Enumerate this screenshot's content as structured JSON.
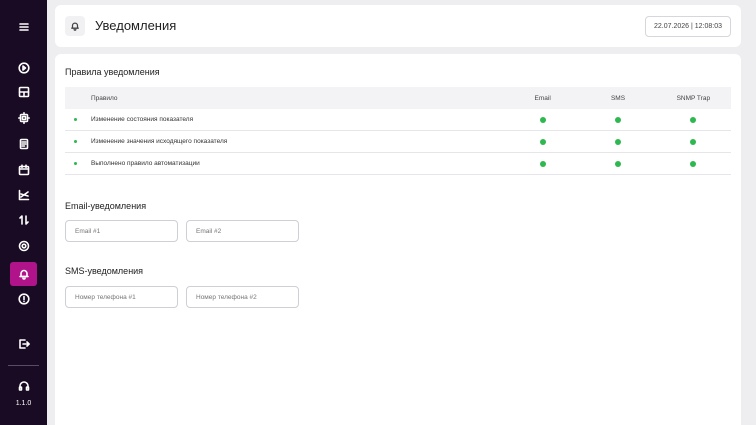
{
  "sidebar": {
    "menu_icon": "menu-icon",
    "items": [
      {
        "icon": "play-circle-icon",
        "active": false
      },
      {
        "icon": "dashboard-icon",
        "active": false
      },
      {
        "icon": "chip-icon",
        "active": false
      },
      {
        "icon": "document-icon",
        "active": false
      },
      {
        "icon": "calendar-icon",
        "active": false
      },
      {
        "icon": "chart-icon",
        "active": false
      },
      {
        "icon": "transfer-icon",
        "active": false
      },
      {
        "icon": "settings-icon",
        "active": false
      },
      {
        "icon": "bell-icon",
        "active": true
      },
      {
        "icon": "info-icon",
        "active": false
      }
    ],
    "logout_icon": "logout-icon",
    "support_icon": "headset-icon",
    "version": "1.1.0"
  },
  "header": {
    "title": "Уведомления",
    "datetime": "22.07.2026 | 12:08:03"
  },
  "rules": {
    "title": "Правила уведомления",
    "columns": [
      "Правило",
      "Email",
      "SMS",
      "SNMP Trap"
    ],
    "rows": [
      {
        "name": "Изменение состояния показателя",
        "email": true,
        "sms": true,
        "snmp": true
      },
      {
        "name": "Изменение значения исходящего показателя",
        "email": true,
        "sms": true,
        "snmp": true
      },
      {
        "name": "Выполнено правило автоматизации",
        "email": true,
        "sms": true,
        "snmp": true
      }
    ]
  },
  "email": {
    "title": "Email-уведомления",
    "placeholder1": "Email #1",
    "placeholder2": "Email #2"
  },
  "sms": {
    "title": "SMS-уведомления",
    "placeholder1": "Номер телефона #1",
    "placeholder2": "Номер телефона #2"
  },
  "colors": {
    "sidebar_bg": "#1a0b24",
    "accent": "#b1148a",
    "status_green": "#2eb84f"
  }
}
